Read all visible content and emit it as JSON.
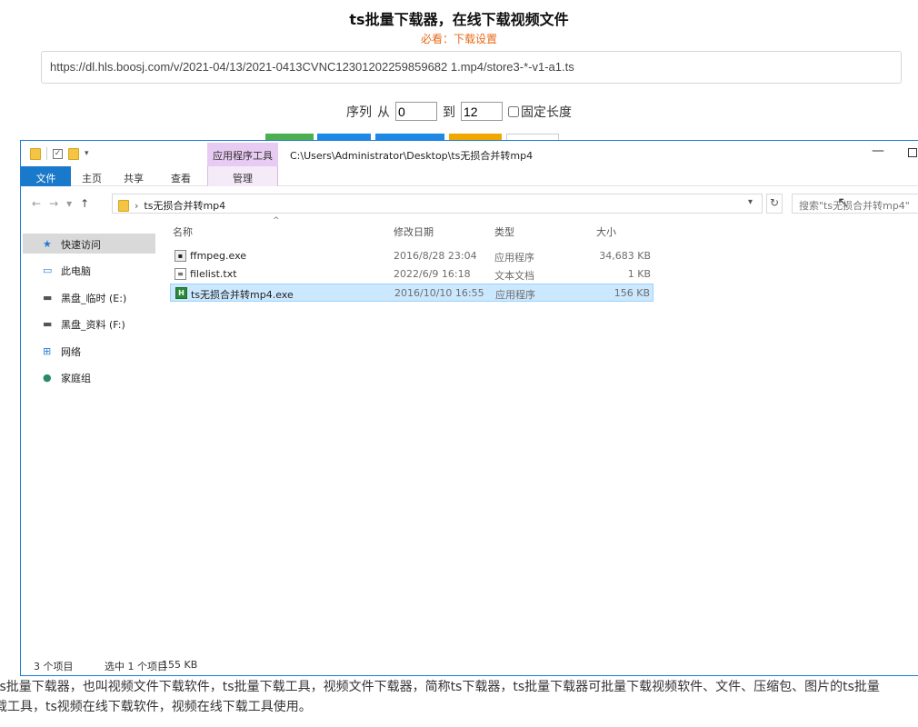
{
  "page": {
    "title": "ts批量下载器，在线下载视频文件",
    "notice": "必看：下载设置",
    "url": "https://dl.hls.boosj.com/v/2021-04/13/2021-0413CVNC12301202259859682 1.mp4/store3-*-v1-a1.ts",
    "range": {
      "seq_label": "序列",
      "from_label": "从",
      "from_value": "0",
      "to_label": "到",
      "to_value": "12",
      "fixed_len_label": "固定长度"
    },
    "description_line1": "ts批量下载器，也叫视频文件下载软件，ts批量下载工具，视频文件下载器，简称ts下载器，ts批量下载器可批量下载视频软件、文件、压缩包、图片的ts批量",
    "description_line2": "载工具，ts视频在线下载软件，视频在线下载工具使用。"
  },
  "explorer": {
    "context_tab": "应用程序工具",
    "path_title": "C:\\Users\\Administrator\\Desktop\\ts无损合并转mp4",
    "tabs": {
      "file": "文件",
      "home": "主页",
      "share": "共享",
      "view": "查看",
      "manage": "管理"
    },
    "address": "ts无损合并转mp4",
    "search_placeholder": "搜索\"ts无损合并转mp4\"",
    "nav_items": [
      {
        "label": "快速访问",
        "icon": "star-icon"
      },
      {
        "label": "此电脑",
        "icon": "computer-icon"
      },
      {
        "label": "黑盘_临时 (E:)",
        "icon": "drive-icon"
      },
      {
        "label": "黑盘_资料 (F:)",
        "icon": "drive-icon"
      },
      {
        "label": "网络",
        "icon": "network-icon"
      },
      {
        "label": "家庭组",
        "icon": "homegroup-icon"
      }
    ],
    "columns": {
      "name": "名称",
      "date": "修改日期",
      "type": "类型",
      "size": "大小"
    },
    "files": [
      {
        "name": "ffmpeg.exe",
        "date": "2016/8/28  23:04",
        "type": "应用程序",
        "size": "34,683 KB"
      },
      {
        "name": "filelist.txt",
        "date": "2022/6/9  16:18",
        "type": "文本文档",
        "size": "1 KB"
      },
      {
        "name": "ts无损合并转mp4.exe",
        "date": "2016/10/10  16:55",
        "type": "应用程序",
        "size": "156 KB"
      }
    ],
    "status": {
      "count": "3 个项目",
      "selected": "选中 1 个项目",
      "selected_size": "155 KB"
    }
  }
}
